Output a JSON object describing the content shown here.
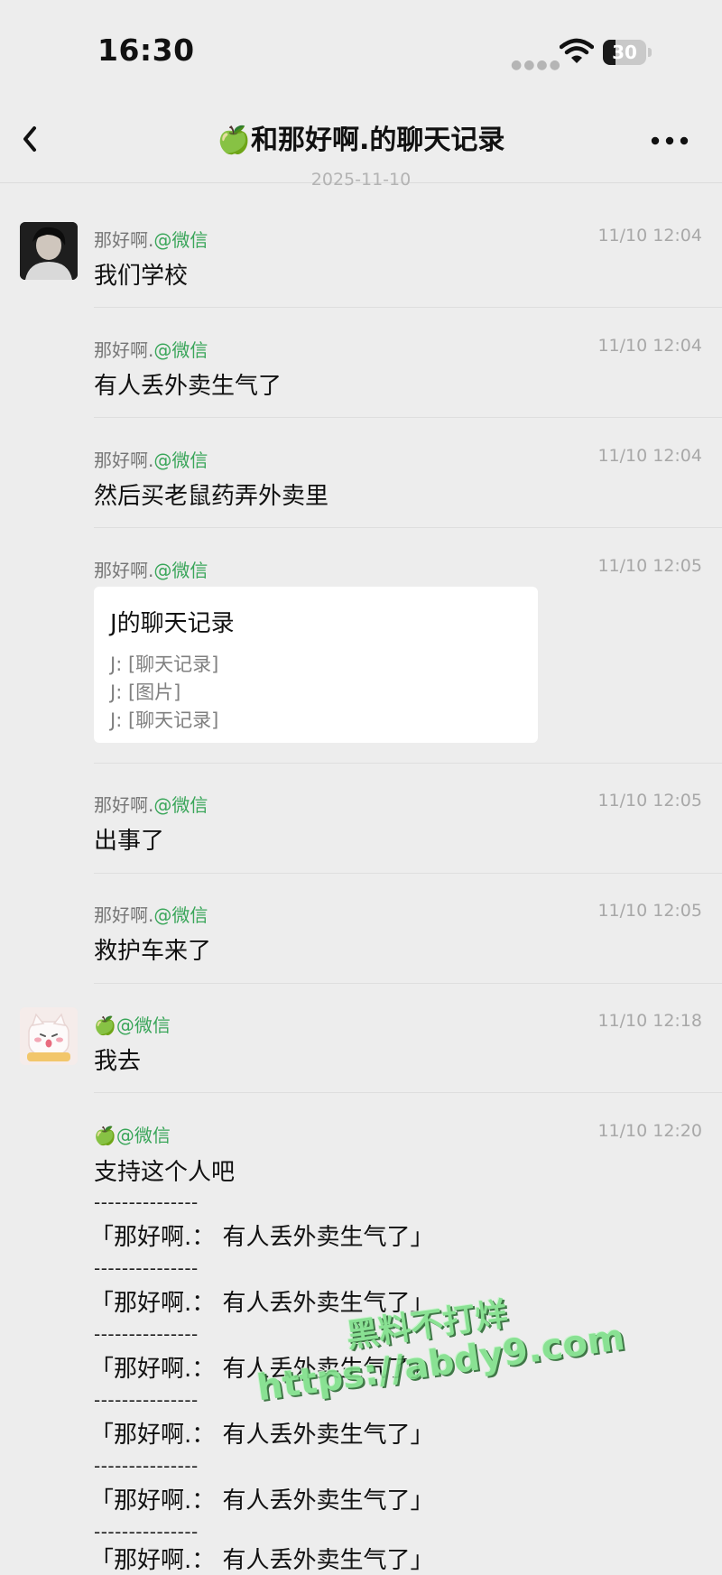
{
  "status_bar": {
    "time": "16:30",
    "battery": "30",
    "battery_level_percent": 30
  },
  "nav": {
    "title": "🍏和那好啊.的聊天记录"
  },
  "date_separator": "2025-11-10",
  "sender_a": {
    "name": "那好啊.",
    "platform": "@微信"
  },
  "sender_b": {
    "name": "🍏",
    "platform": "@微信"
  },
  "messages": [
    {
      "time": "11/10 12:04",
      "text": "我们学校"
    },
    {
      "time": "11/10 12:04",
      "text": "有人丢外卖生气了"
    },
    {
      "time": "11/10 12:04",
      "text": "然后买老鼠药弄外卖里"
    },
    {
      "time": "11/10 12:05"
    },
    {
      "time": "11/10 12:05",
      "text": "出事了"
    },
    {
      "time": "11/10 12:05",
      "text": "救护车来了"
    },
    {
      "time": "11/10 12:18",
      "text": "我去"
    },
    {
      "time": "11/10 12:20",
      "text": "支持这个人吧"
    }
  ],
  "card": {
    "title": "J的聊天记录",
    "lines": [
      "J: [聊天记录]",
      "J: [图片]",
      "J: [聊天记录]"
    ]
  },
  "quote": {
    "separator": "---------------",
    "line": "「那好啊.： 有人丢外卖生气了」"
  },
  "watermark": {
    "line1": "黑料不打烊",
    "line2": "https://abdy9.com"
  },
  "colors": {
    "background": "#ededed",
    "platform_green": "#3aa65a",
    "watermark_green": "#7fe08a"
  }
}
